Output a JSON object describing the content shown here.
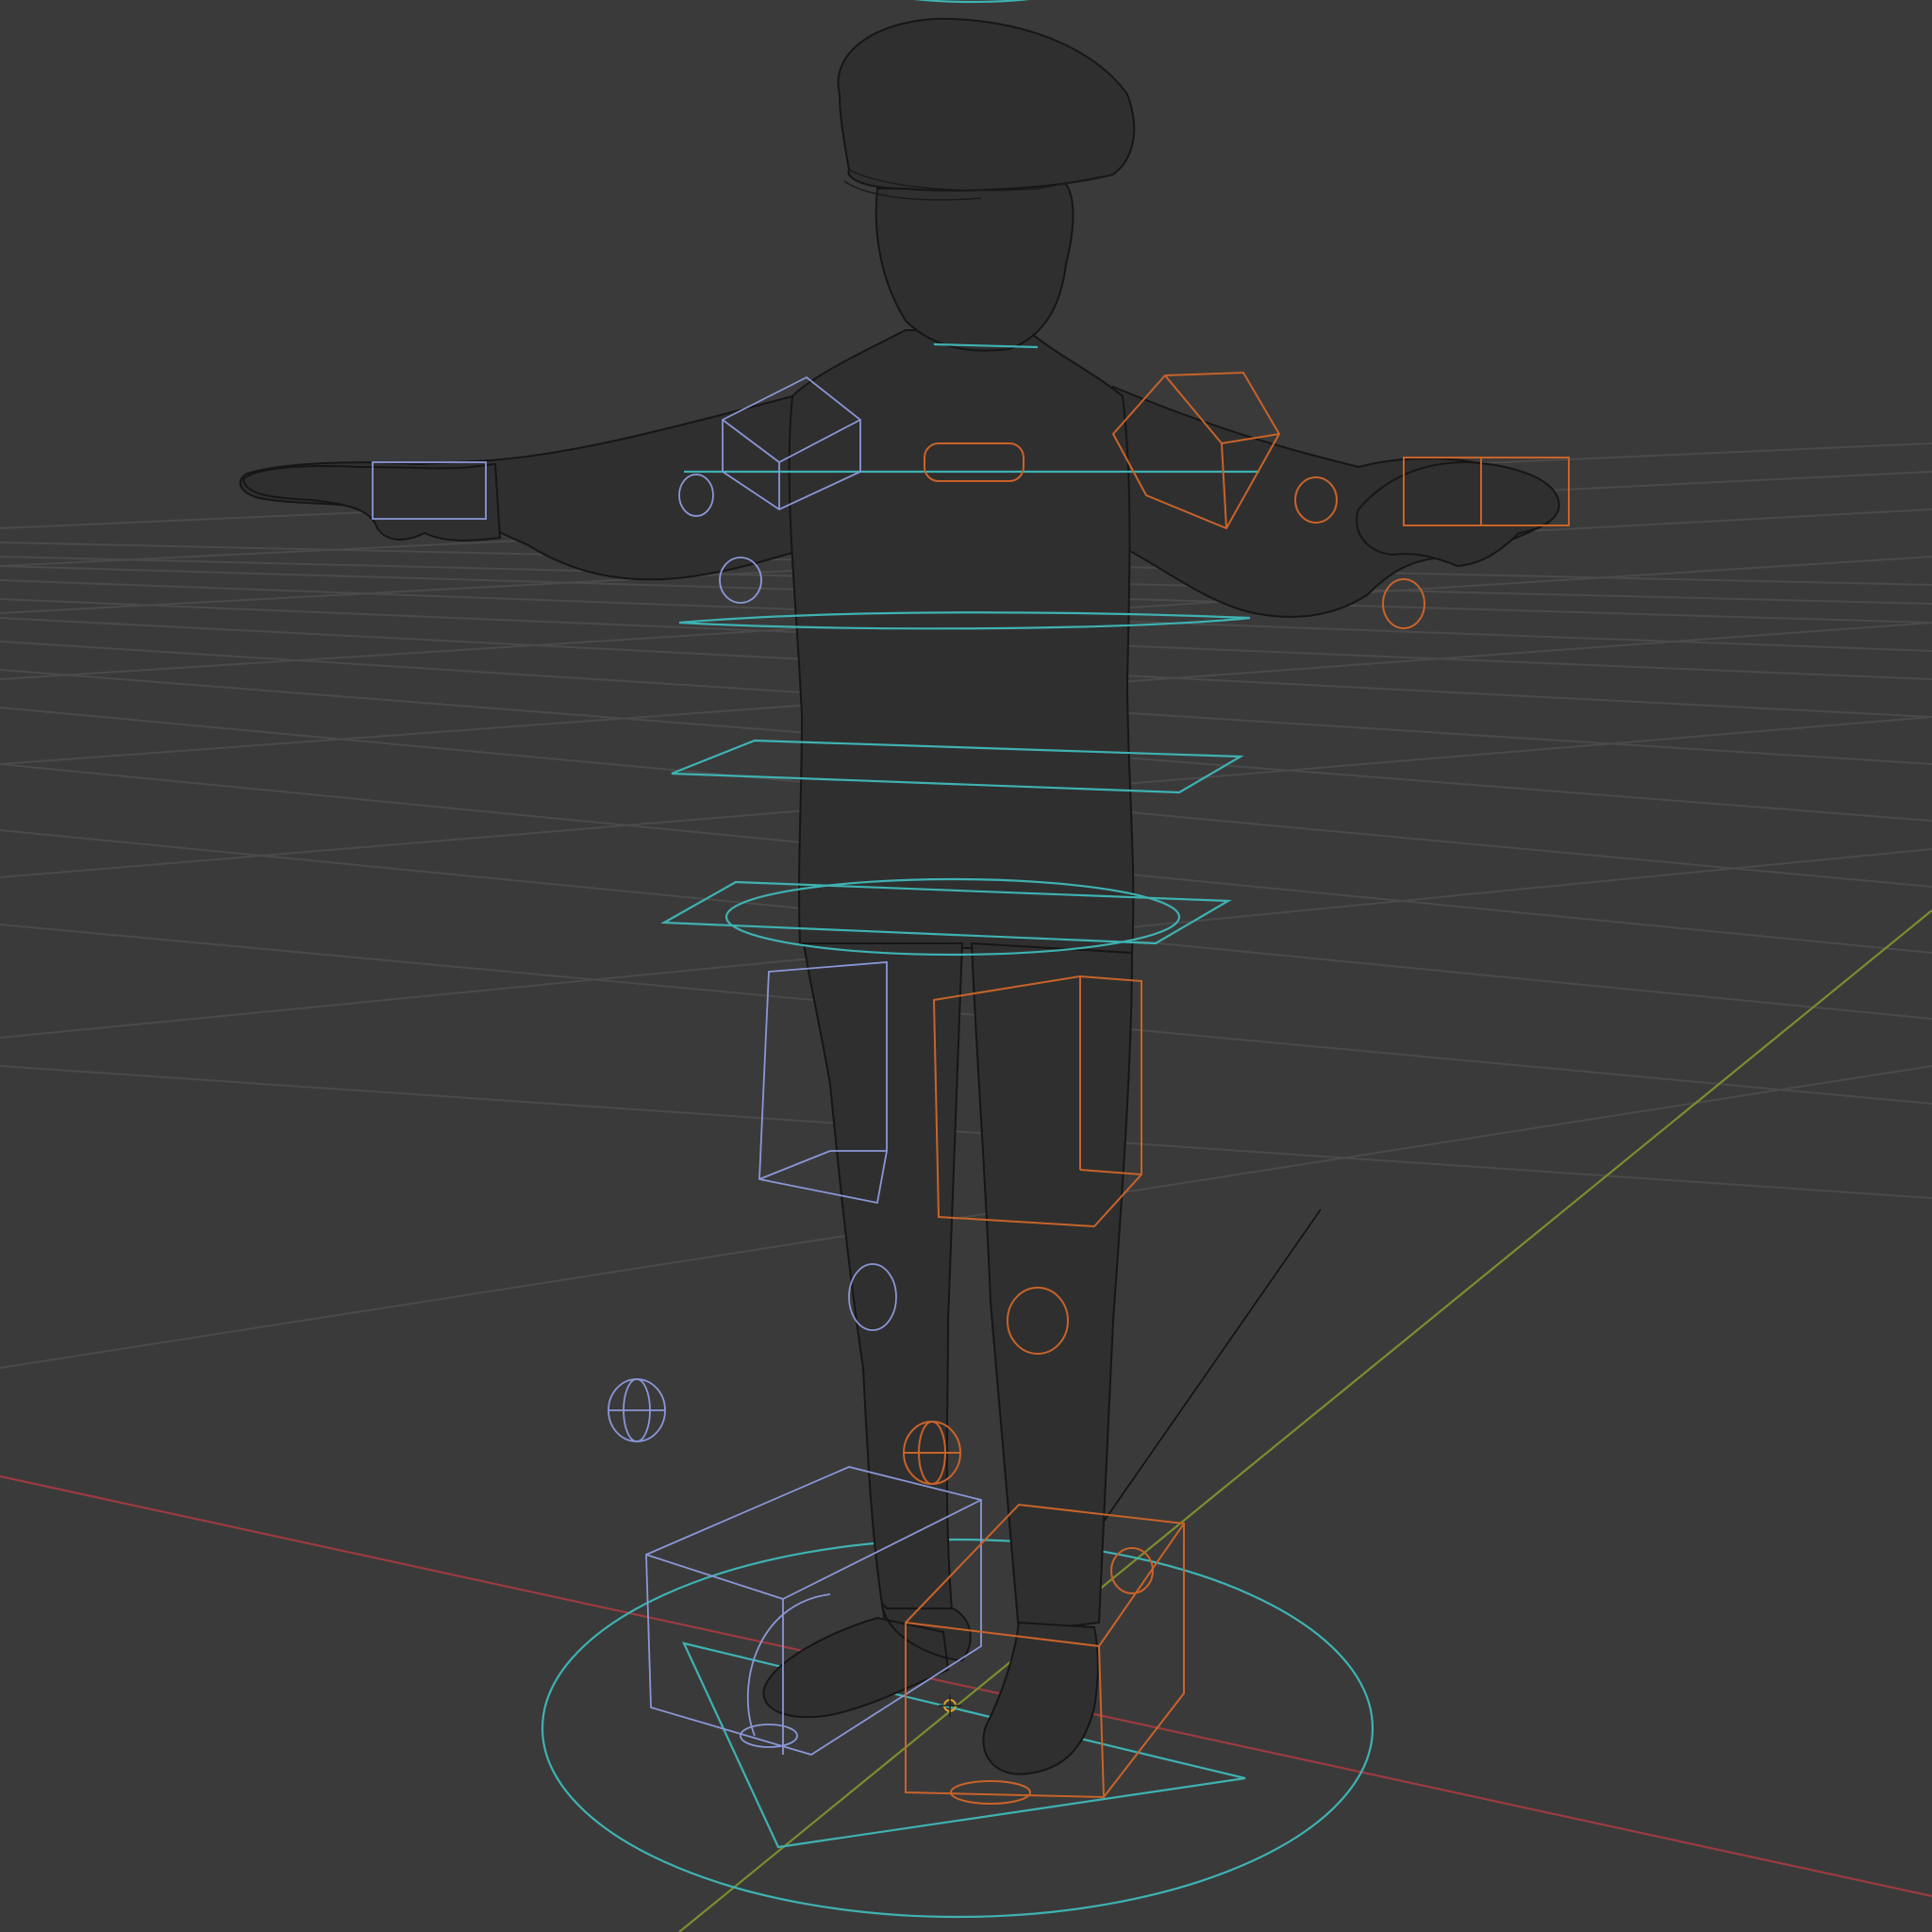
{
  "viewport": {
    "background_color": "#3a3a3a",
    "grid_color": "#4a4a4a",
    "x_axis_color": "#9b3b40",
    "y_axis_color": "#7a8f2e"
  },
  "scene": {
    "mode": "wireframe",
    "object": "character rig",
    "controls": {
      "root_color": "#3fb2b2",
      "left_side_color": "#8a97d6",
      "right_side_color": "#c8632a"
    },
    "icons": [
      "3d-cursor-icon"
    ]
  }
}
